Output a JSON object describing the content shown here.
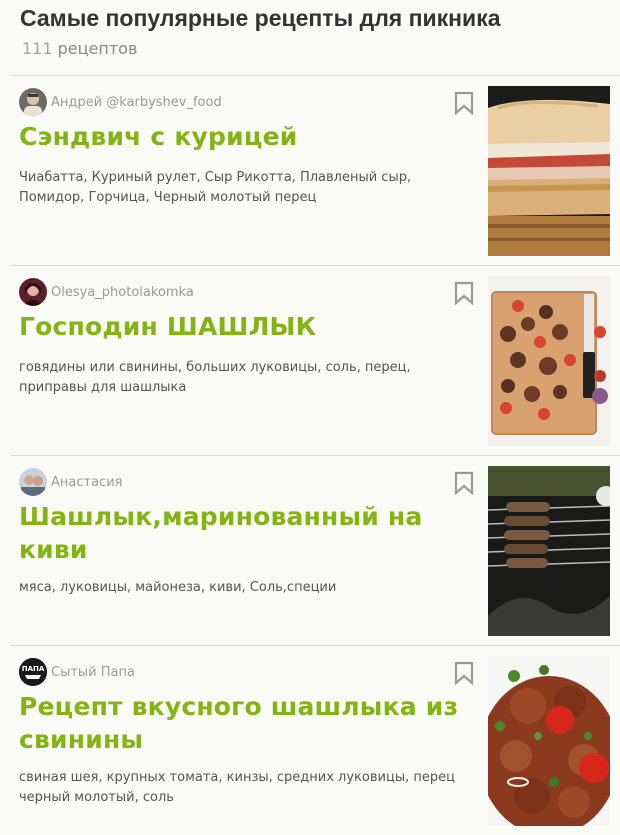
{
  "page": {
    "title": "Самые популярные рецепты для пикника",
    "count_number": "111",
    "count_word": "рецептов"
  },
  "colors": {
    "accent": "#84b414",
    "background": "#fafaf6",
    "muted": "#9a9a9a",
    "divider": "#dcdcd6"
  },
  "recipes": [
    {
      "author": "Андрей @karbyshev_food",
      "title": "Сэндвич с курицей",
      "ingredients": "Чиабатта, Куриный рулет, Сыр Рикотта, Плавленый сыр, Помидор, Горчица, Черный молотый перец",
      "bookmark_icon": "bookmark-icon",
      "image": "chicken-sandwich-photo"
    },
    {
      "author": "Olesya_photolakomka",
      "title": "Господин ШАШЛЫК",
      "ingredients": "говядины или свинины, больших луковицы, соль, перец, приправы для шашлыка",
      "bookmark_icon": "bookmark-icon",
      "image": "kebab-on-cutting-board-photo"
    },
    {
      "author": "Анастасия",
      "title": "Шашлык,маринованный на киви",
      "ingredients": "мяса, луковицы, майонеза, киви, Соль,специи",
      "bookmark_icon": "bookmark-icon",
      "image": "kebab-on-grill-photo"
    },
    {
      "author": "Сытый Папа",
      "author_logo_text": "ПАПА",
      "title": "Рецепт вкусного шашлыка из свинины",
      "ingredients": "свиная шея, крупных томата, кинзы, средних луковицы, перец черный молотый, соль",
      "bookmark_icon": "bookmark-icon",
      "image": "pork-kebab-plate-photo"
    }
  ]
}
